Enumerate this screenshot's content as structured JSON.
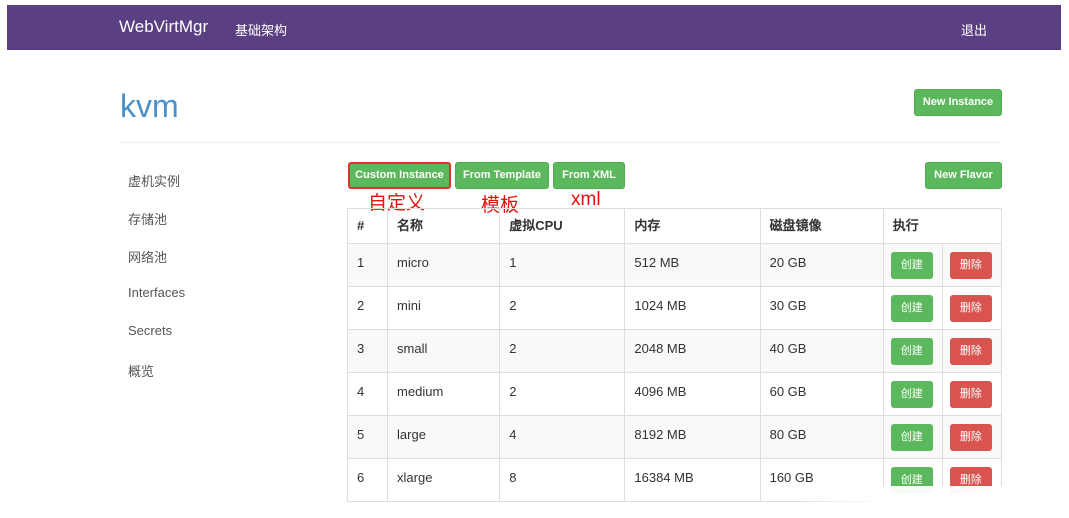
{
  "nav": {
    "brand": "WebVirtMgr",
    "infrastructure": "基础架构",
    "logout": "退出"
  },
  "page": {
    "title": "kvm"
  },
  "sidebar": {
    "items": [
      {
        "label": "虚机实例"
      },
      {
        "label": "存储池"
      },
      {
        "label": "网络池"
      },
      {
        "label": "Interfaces"
      },
      {
        "label": "Secrets"
      },
      {
        "label": "概览"
      }
    ]
  },
  "toolbar": {
    "new_instance": "New Instance",
    "custom_instance": "Custom Instance",
    "from_template": "From Template",
    "from_xml": "From XML",
    "new_flavor": "New Flavor"
  },
  "annotations": {
    "custom": "自定义",
    "template": "模板",
    "xml": "xml"
  },
  "table": {
    "headers": [
      "#",
      "名称",
      "虚拟CPU",
      "内存",
      "磁盘镜像",
      "执行"
    ],
    "create_label": "创建",
    "delete_label": "删除",
    "rows": [
      {
        "id": "1",
        "name": "micro",
        "vcpu": "1",
        "memory": "512 MB",
        "disk": "20 GB"
      },
      {
        "id": "2",
        "name": "mini",
        "vcpu": "2",
        "memory": "1024 MB",
        "disk": "30 GB"
      },
      {
        "id": "3",
        "name": "small",
        "vcpu": "2",
        "memory": "2048 MB",
        "disk": "40 GB"
      },
      {
        "id": "4",
        "name": "medium",
        "vcpu": "2",
        "memory": "4096 MB",
        "disk": "60 GB"
      },
      {
        "id": "5",
        "name": "large",
        "vcpu": "4",
        "memory": "8192 MB",
        "disk": "80 GB"
      },
      {
        "id": "6",
        "name": "xlarge",
        "vcpu": "8",
        "memory": "16384 MB",
        "disk": "160 GB"
      }
    ]
  },
  "colors": {
    "navbar": "#5b3f83",
    "title": "#4a90c9",
    "success": "#5cb85c",
    "danger": "#d9534f",
    "annotation": "#e3120b"
  }
}
